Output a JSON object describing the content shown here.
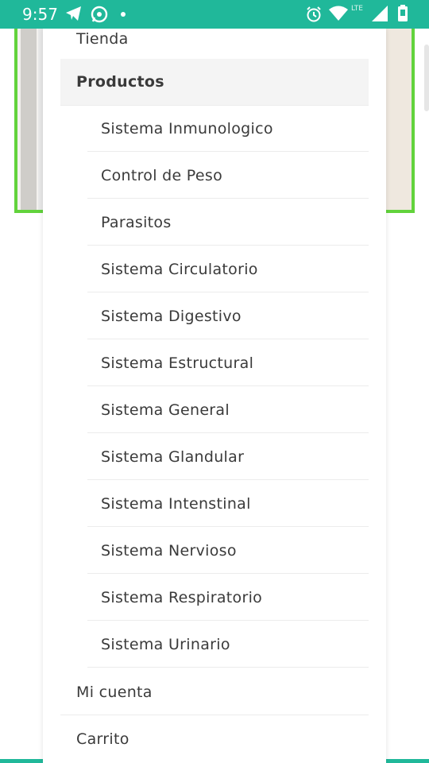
{
  "status_bar": {
    "time": "9:57",
    "network_label": "LTE",
    "icons": [
      "telegram-icon",
      "whatsapp-icon",
      "notification-dot-icon",
      "alarm-icon",
      "wifi-icon",
      "signal-icon",
      "battery-icon"
    ]
  },
  "colors": {
    "status_bar_bg": "#20b89a",
    "banner_border": "#62d33c",
    "menu_text": "#3a3a3a",
    "active_bg": "#f4f4f4"
  },
  "menu": {
    "items": [
      {
        "label": "Tienda"
      },
      {
        "label": "Productos",
        "active": true
      },
      {
        "label": "Mi cuenta"
      },
      {
        "label": "Carrito"
      }
    ],
    "submenu": [
      {
        "label": "Sistema Inmunologico"
      },
      {
        "label": "Control de Peso"
      },
      {
        "label": "Parasitos"
      },
      {
        "label": "Sistema Circulatorio"
      },
      {
        "label": "Sistema Digestivo"
      },
      {
        "label": "Sistema Estructural"
      },
      {
        "label": "Sistema General"
      },
      {
        "label": "Sistema Glandular"
      },
      {
        "label": "Sistema Intenstinal"
      },
      {
        "label": "Sistema Nervioso"
      },
      {
        "label": "Sistema Respiratorio"
      },
      {
        "label": "Sistema Urinario"
      }
    ]
  }
}
